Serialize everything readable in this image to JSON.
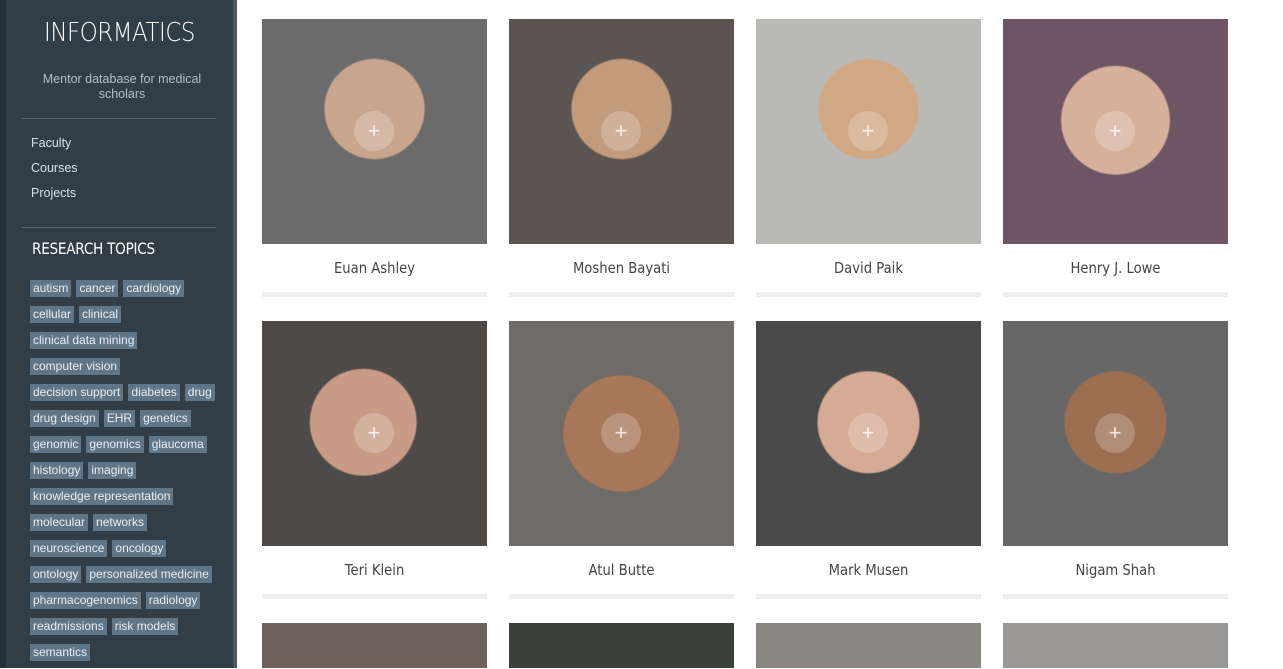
{
  "sidebar": {
    "brand": "INFORMATICS",
    "tagline": "Mentor database for medical scholars",
    "nav": [
      "Faculty",
      "Courses",
      "Projects"
    ],
    "topics_title": "RESEARCH TOPICS",
    "tags": [
      "autism",
      "cancer",
      "cardiology",
      "cellular",
      "clinical",
      "clinical data mining",
      "computer vision",
      "decision support",
      "diabetes",
      "drug",
      "drug design",
      "EHR",
      "genetics",
      "genomic",
      "genomics",
      "glaucoma",
      "histology",
      "imaging",
      "knowledge representation",
      "molecular",
      "networks",
      "neuroscience",
      "oncology",
      "ontology",
      "personalized medicine",
      "pharmacogenomics",
      "radiology",
      "readmissions",
      "risk models",
      "semantics"
    ]
  },
  "faculty": [
    {
      "name": "Euan Ashley",
      "icon": "plus-icon"
    },
    {
      "name": "Moshen Bayati",
      "icon": "plus-icon"
    },
    {
      "name": "David Paik",
      "icon": "plus-icon"
    },
    {
      "name": "Henry J. Lowe",
      "icon": "plus-icon"
    },
    {
      "name": "Teri Klein",
      "icon": "plus-icon"
    },
    {
      "name": "Atul Butte",
      "icon": "plus-icon"
    },
    {
      "name": "Mark Musen",
      "icon": "plus-icon"
    },
    {
      "name": "Nigam Shah",
      "icon": "plus-icon"
    }
  ],
  "colors": {
    "sidebar": "#323e47",
    "tag": "#5f7688"
  }
}
